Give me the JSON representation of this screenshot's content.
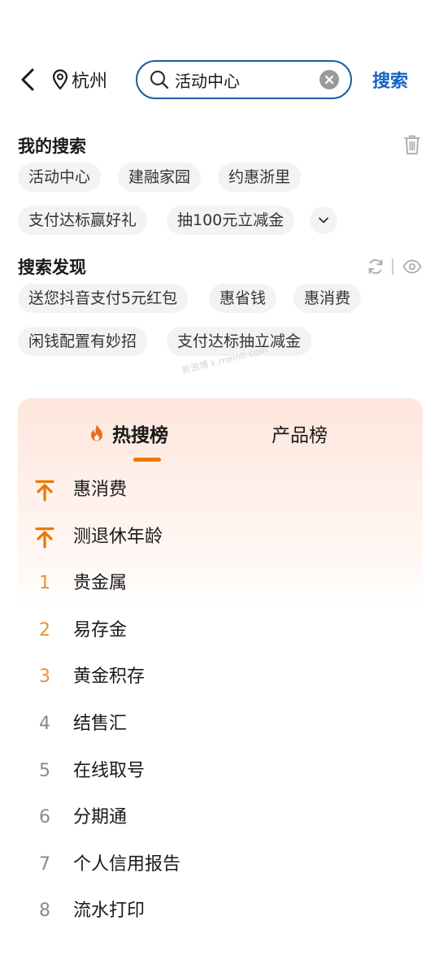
{
  "header": {
    "city": "杭州",
    "search_value": "活动中心",
    "search_button": "搜索"
  },
  "my_search": {
    "title": "我的搜索",
    "items": [
      "活动中心",
      "建融家园",
      "约惠浙里",
      "支付达标赢好礼",
      "抽100元立减金"
    ]
  },
  "discover": {
    "title": "搜索发现",
    "items": [
      "送您抖音支付5元红包",
      "惠省钱",
      "惠消费",
      "闲钱配置有妙招",
      "支付达标抽立减金"
    ]
  },
  "watermark": "新浪博 k.meinb.com",
  "hot": {
    "tabs": [
      "热搜榜",
      "产品榜"
    ],
    "active_tab": "热搜榜",
    "items": [
      {
        "rank": "",
        "pinned": true,
        "text": "惠消费"
      },
      {
        "rank": "",
        "pinned": true,
        "text": "测退休年龄"
      },
      {
        "rank": "1",
        "pinned": false,
        "text": "贵金属"
      },
      {
        "rank": "2",
        "pinned": false,
        "text": "易存金"
      },
      {
        "rank": "3",
        "pinned": false,
        "text": "黄金积存"
      },
      {
        "rank": "4",
        "pinned": false,
        "text": "结售汇"
      },
      {
        "rank": "5",
        "pinned": false,
        "text": "在线取号"
      },
      {
        "rank": "6",
        "pinned": false,
        "text": "分期通"
      },
      {
        "rank": "7",
        "pinned": false,
        "text": "个人信用报告"
      },
      {
        "rank": "8",
        "pinned": false,
        "text": "流水打印"
      }
    ]
  },
  "colors": {
    "accent_blue": "#1565c0",
    "search_border": "#1b5fa6",
    "hot_orange": "#ee7700",
    "rank_top": "#e8923a",
    "rank_normal": "#8a8a8a",
    "chip_bg": "#f2f3f5"
  },
  "icons": {
    "back": "back-arrow-icon",
    "location": "location-pin-icon",
    "search": "search-icon",
    "clear": "clear-icon",
    "delete": "trash-icon",
    "expand": "chevron-down-icon",
    "refresh": "refresh-icon",
    "visibility": "eye-icon",
    "hot": "flame-icon",
    "pinned": "pin-top-icon"
  }
}
